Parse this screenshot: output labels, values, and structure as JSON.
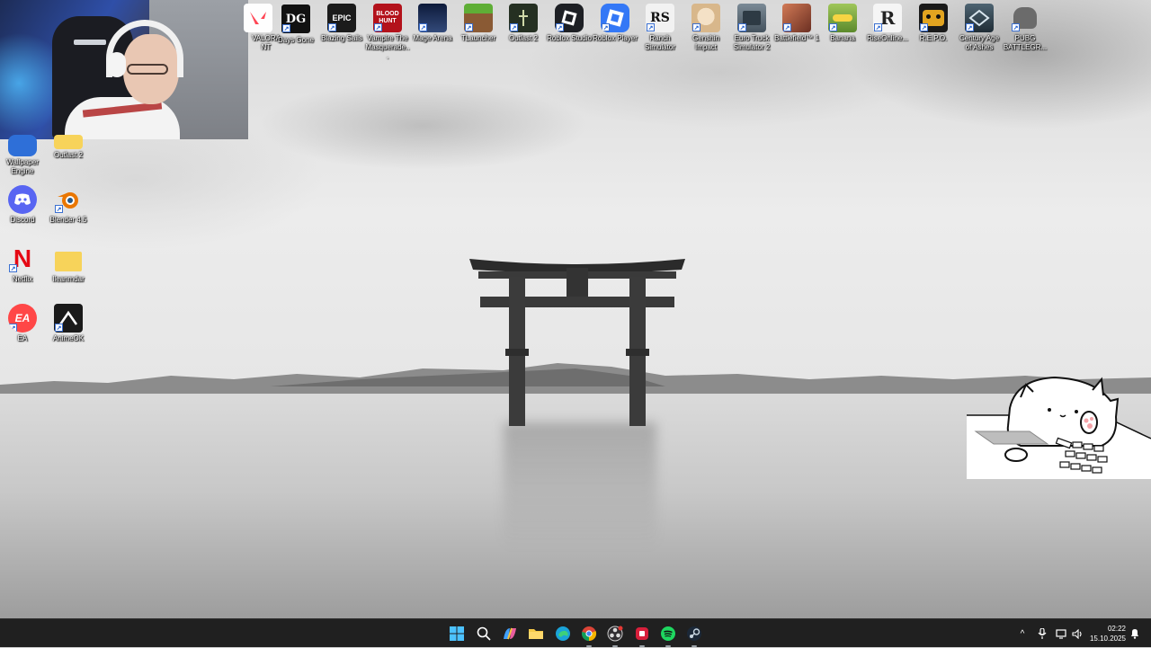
{
  "top_icons": [
    {
      "label": "VALORANT",
      "icon": "valorant-icon",
      "color": "#e84057"
    },
    {
      "label": "Days Gone",
      "icon": "days-gone-icon",
      "color": "#111111"
    },
    {
      "label": "Blazing Sails",
      "icon": "epic-games-icon",
      "color": "#1b1b1b"
    },
    {
      "label": "Vampire The Masquerade...",
      "icon": "bloodhunt-icon",
      "color": "#b3121b"
    },
    {
      "label": "Mage Arena",
      "icon": "mage-arena-icon",
      "color": "#1e2a48"
    },
    {
      "label": "TLauncher",
      "icon": "minecraft-icon",
      "color": "#4e8a2c"
    },
    {
      "label": "Outlast 2",
      "icon": "outlast-icon",
      "color": "#253022"
    },
    {
      "label": "Roblox Studio",
      "icon": "roblox-studio-icon",
      "color": "#1d1f24"
    },
    {
      "label": "Roblox Player",
      "icon": "roblox-player-icon",
      "color": "#3478f6"
    },
    {
      "label": "Ranch Simulator",
      "icon": "ranch-simulator-icon",
      "color": "#f2f2f2"
    },
    {
      "label": "Genshin Impact",
      "icon": "genshin-icon",
      "color": "#e9d7b9"
    },
    {
      "label": "Euro Truck Simulator 2",
      "icon": "truck-icon",
      "color": "#44525d"
    },
    {
      "label": "Battlefield™ 1",
      "icon": "battlefield-icon",
      "color": "#a0523d"
    },
    {
      "label": "Banana",
      "icon": "banana-icon",
      "color": "#87b34a"
    },
    {
      "label": "RiseOnline...",
      "icon": "rise-online-icon",
      "color": "#f5f5f5"
    },
    {
      "label": "R.E.P.O.",
      "icon": "repo-icon",
      "color": "#e2a420"
    },
    {
      "label": "Century Age of Ashes",
      "icon": "century-icon",
      "color": "#2c3d48"
    },
    {
      "label": "PUBG BATTLEGR...",
      "icon": "pubg-icon",
      "color": "#d6d6d6"
    }
  ],
  "left_icons": [
    {
      "label": "Wallpaper Engine",
      "icon": "wallpaper-engine-icon",
      "color": "#2e6fd8"
    },
    {
      "label": "Outlast 2",
      "icon": "folder-icon",
      "color": "#f7d35a"
    },
    {
      "label": "Discord",
      "icon": "discord-icon",
      "color": "#5865f2"
    },
    {
      "label": "Blender 4.5",
      "icon": "blender-icon",
      "color": "#ea7600"
    },
    {
      "label": "Netflix",
      "icon": "netflix-icon",
      "color": "#e50914"
    },
    {
      "label": "Ileanmdar",
      "icon": "folder-icon",
      "color": "#f7d35a"
    },
    {
      "label": "EA",
      "icon": "ea-icon",
      "color": "#ff4747"
    },
    {
      "label": "AnimeOK",
      "icon": "animeok-icon",
      "color": "#1a1a1a"
    }
  ],
  "icon_glyphs": {
    "days_gone": "DG",
    "epic": "EPIC",
    "blood": "BLOOD HUNT",
    "roblox": "■",
    "ranch": "RS",
    "rise": "R",
    "netflix": "N",
    "ea": "EA",
    "shortcut_arrow": "↗"
  },
  "taskbar": {
    "apps": [
      "start-icon",
      "search-icon",
      "copilot-icon",
      "file-explorer-icon",
      "edge-icon",
      "chrome-icon",
      "obs-icon",
      "red-app-icon",
      "spotify-icon",
      "steam-icon"
    ],
    "tray": {
      "chevron": "^",
      "time": "02:22",
      "date": "15.10.2025"
    }
  },
  "colors": {
    "taskbar_bg": "#202020",
    "accent_blue": "#2f8cff",
    "icon_text": "#ffffff"
  }
}
